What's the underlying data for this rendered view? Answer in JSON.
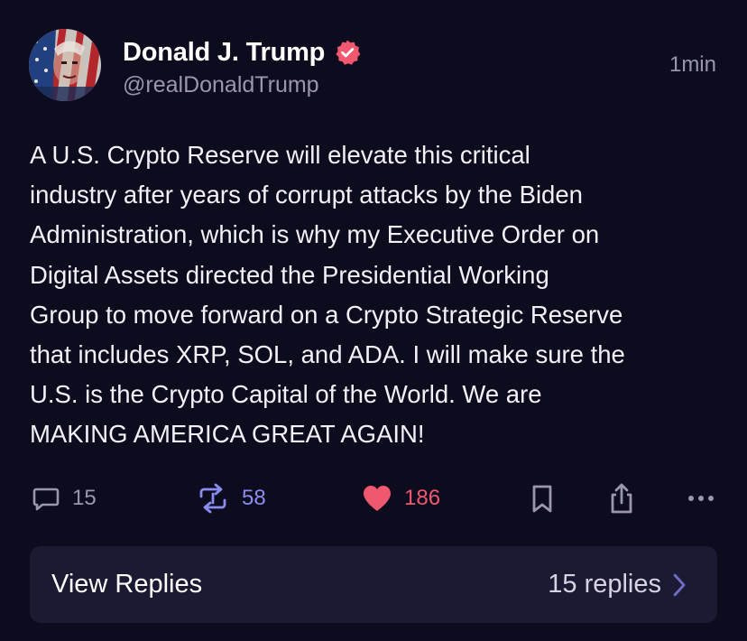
{
  "post": {
    "author": {
      "display_name": "Donald J. Trump",
      "handle": "@realDonaldTrump",
      "verified": true,
      "avatar": "avatar-flag-portrait"
    },
    "timestamp": "1min",
    "body": "A U.S. Crypto Reserve will elevate this critical\nindustry after years of corrupt attacks by the Biden\nAdministration, which is why my Executive Order on\nDigital Assets directed the Presidential Working\nGroup to move forward on a Crypto Strategic Reserve\nthat includes XRP, SOL, and ADA. I will make sure the\nU.S. is the Crypto Capital of the World. We are\nMAKING AMERICA GREAT AGAIN!",
    "actions": {
      "replies": "15",
      "reposts": "58",
      "likes": "186",
      "icons": [
        "reply-icon",
        "repost-icon",
        "heart-icon",
        "bookmark-icon",
        "share-icon",
        "more-icon"
      ]
    },
    "view_replies": {
      "label": "View Replies",
      "count_label": "15 replies"
    }
  },
  "colors": {
    "background": "#0d0b1e",
    "muted": "#9a97ad",
    "repost": "#8b8cf0",
    "like": "#f0586f",
    "verified": "#f0586f",
    "card": "#1c1a33"
  }
}
